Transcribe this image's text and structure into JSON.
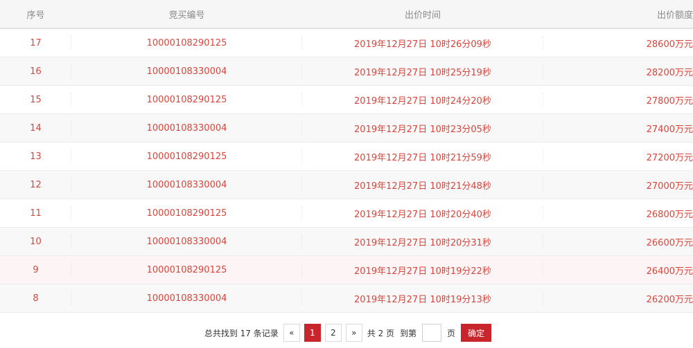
{
  "table": {
    "headers": [
      "序号",
      "竞买编号",
      "出价时间",
      "出价额度"
    ],
    "rows": [
      {
        "no": "17",
        "bidder": "10000108290125",
        "time": "2019年12月27日 10时26分09秒",
        "amount": "28600万元"
      },
      {
        "no": "16",
        "bidder": "10000108330004",
        "time": "2019年12月27日 10时25分19秒",
        "amount": "28200万元"
      },
      {
        "no": "15",
        "bidder": "10000108290125",
        "time": "2019年12月27日 10时24分20秒",
        "amount": "27800万元"
      },
      {
        "no": "14",
        "bidder": "10000108330004",
        "time": "2019年12月27日 10时23分05秒",
        "amount": "27400万元"
      },
      {
        "no": "13",
        "bidder": "10000108290125",
        "time": "2019年12月27日 10时21分59秒",
        "amount": "27200万元"
      },
      {
        "no": "12",
        "bidder": "10000108330004",
        "time": "2019年12月27日 10时21分48秒",
        "amount": "27000万元"
      },
      {
        "no": "11",
        "bidder": "10000108290125",
        "time": "2019年12月27日 10时20分40秒",
        "amount": "26800万元"
      },
      {
        "no": "10",
        "bidder": "10000108330004",
        "time": "2019年12月27日 10时20分31秒",
        "amount": "26600万元"
      },
      {
        "no": "9",
        "bidder": "10000108290125",
        "time": "2019年12月27日 10时19分22秒",
        "amount": "26400万元"
      },
      {
        "no": "8",
        "bidder": "10000108330004",
        "time": "2019年12月27日 10时19分13秒",
        "amount": "26200万元"
      }
    ]
  },
  "pager": {
    "total_prefix": "总共找到",
    "total_count": "17",
    "total_suffix": "条记录",
    "prev": "«",
    "pages": [
      "1",
      "2"
    ],
    "next": "»",
    "page_total_prefix": "共",
    "page_total": "2",
    "page_total_suffix": "页",
    "goto_label": "到第",
    "goto_value": "",
    "goto_suffix": "页",
    "confirm": "确定"
  },
  "colors": {
    "accent": "#c8262c",
    "cell_text": "#d9443a",
    "header_text": "#8a8a8a"
  }
}
